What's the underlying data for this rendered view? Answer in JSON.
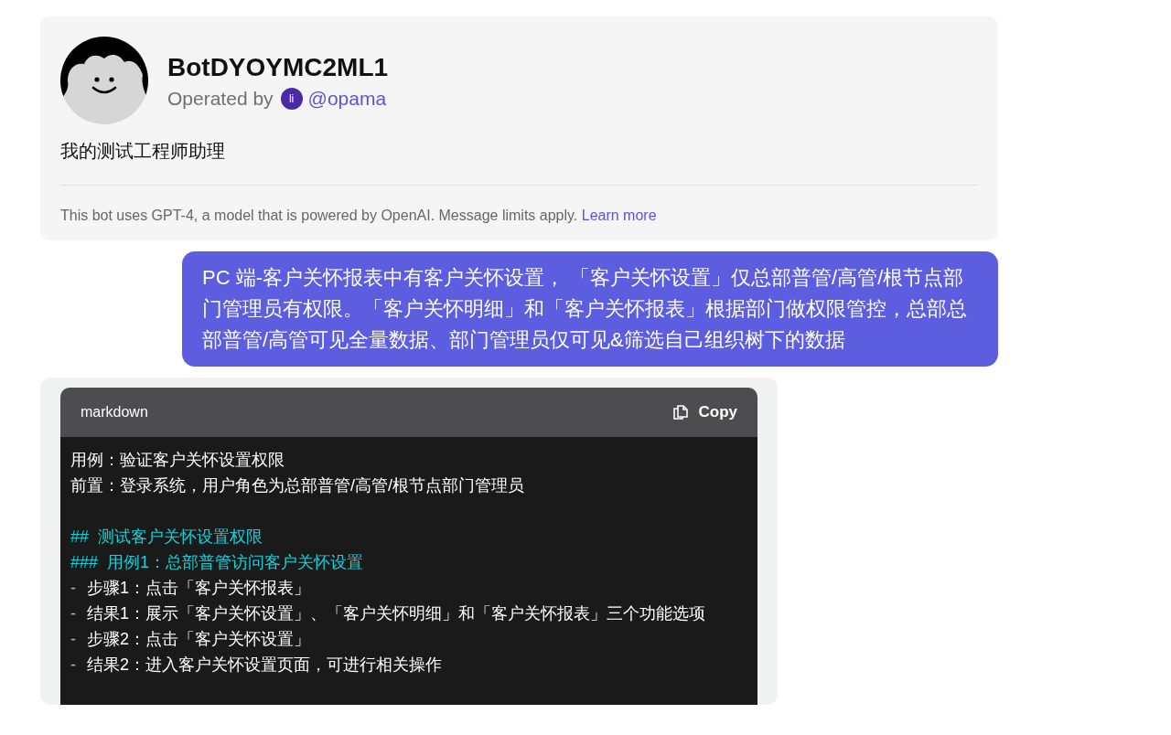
{
  "bot_card": {
    "name": "BotDYOYMC2ML1",
    "operated_by": "Operated by",
    "operator_badge": "li",
    "operator": "@opama",
    "description": "我的测试工程师助理",
    "footer": "This bot uses GPT-4, a model that is powered by OpenAI. Message limits apply.",
    "footer_link": "Learn more"
  },
  "user_message": {
    "text": "PC 端-客户关怀报表中有客户关怀设置， 「客户关怀设置」仅总部普管/高管/根节点部门管理员有权限。「客户关怀明细」和「客户关怀报表」根据部门做权限管控，总部总部普管/高管可见全量数据、部门管理员仅可见&筛选自己组织树下的数据"
  },
  "code_block": {
    "language": "markdown",
    "copy_label": "Copy",
    "lines": [
      {
        "kind": "plain",
        "text": "用例：验证客户关怀设置权限"
      },
      {
        "kind": "plain",
        "text": "前置：登录系统，用户角色为总部普管/高管/根节点部门管理员"
      },
      {
        "kind": "blank"
      },
      {
        "kind": "heading",
        "text": "##  测试客户关怀设置权限"
      },
      {
        "kind": "heading",
        "text": "###  用例1：总部普管访问客户关怀设置"
      },
      {
        "kind": "bullet",
        "marker": "-",
        "text": "步骤1：点击「客户关怀报表」"
      },
      {
        "kind": "bullet",
        "marker": "-",
        "text": "结果1：展示「客户关怀设置」、「客户关怀明细」和「客户关怀报表」三个功能选项"
      },
      {
        "kind": "bullet",
        "marker": "-",
        "text": "步骤2：点击「客户关怀设置」"
      },
      {
        "kind": "bullet",
        "marker": "-",
        "text": "结果2：进入客户关怀设置页面，可进行相关操作"
      }
    ]
  }
}
